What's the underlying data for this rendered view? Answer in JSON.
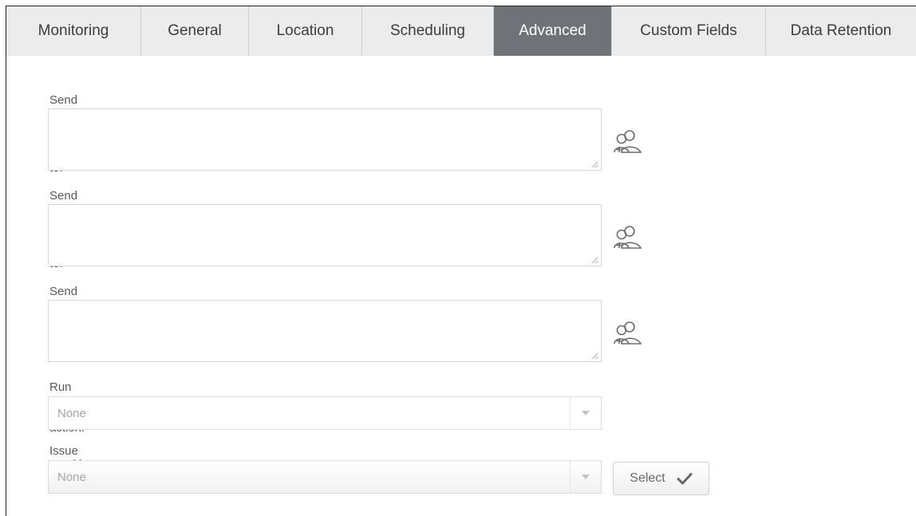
{
  "tabs": [
    {
      "label": "Monitoring",
      "active": false
    },
    {
      "label": "General",
      "active": false
    },
    {
      "label": "Location",
      "active": false
    },
    {
      "label": "Scheduling",
      "active": false
    },
    {
      "label": "Advanced",
      "active": true
    },
    {
      "label": "Custom Fields",
      "active": false
    },
    {
      "label": "Data Retention",
      "active": false
    }
  ],
  "form": {
    "pre_scan_label": "Send pre-scan e-mail to:",
    "pre_scan_value": "",
    "post_scan_label": "Send post-scan e-mail to:",
    "post_scan_value": "",
    "failure_label": "Send scan failure e-mail to:",
    "failure_value": "",
    "post_action_label": "Run post scan action:",
    "post_action_value": "None",
    "issue_tracking_label": "Issue Tracking Settings",
    "issue_tracking_value": "None",
    "select_button_label": "Select"
  },
  "icons": {
    "contacts": "add-contacts-icon",
    "caret": "caret-down-icon",
    "check": "checkmark-icon"
  },
  "colors": {
    "active_tab": "#6f7378",
    "inactive_tab": "#ececec"
  }
}
